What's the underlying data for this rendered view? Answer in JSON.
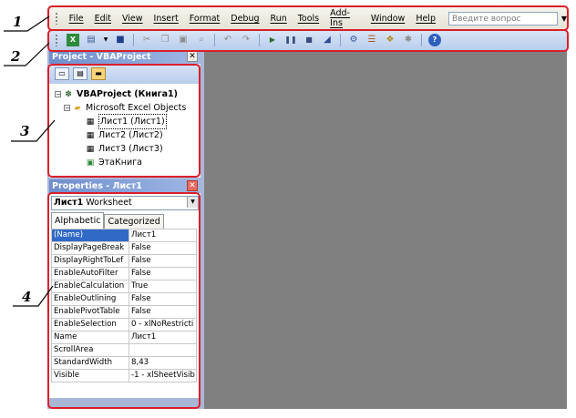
{
  "callouts": [
    "1",
    "2",
    "3",
    "4"
  ],
  "menu": {
    "items": [
      "File",
      "Edit",
      "View",
      "Insert",
      "Format",
      "Debug",
      "Run",
      "Tools",
      "Add-Ins",
      "Window",
      "Help"
    ],
    "help_placeholder": "Введите вопрос"
  },
  "project": {
    "title": "Project - VBAProject",
    "root": "VBAProject (Книга1)",
    "folder": "Microsoft Excel Objects",
    "sheets": [
      "Лист1 (Лист1)",
      "Лист2 (Лист2)",
      "Лист3 (Лист3)"
    ],
    "workbook": "ЭтаКнига"
  },
  "properties": {
    "title": "Properties - Лист1",
    "object_name": "Лист1",
    "object_type": "Worksheet",
    "tabs": [
      "Alphabetic",
      "Categorized"
    ],
    "rows": [
      {
        "key": "(Name)",
        "value": "Лист1"
      },
      {
        "key": "DisplayPageBreak",
        "value": "False"
      },
      {
        "key": "DisplayRightToLef",
        "value": "False"
      },
      {
        "key": "EnableAutoFilter",
        "value": "False"
      },
      {
        "key": "EnableCalculation",
        "value": "True"
      },
      {
        "key": "EnableOutlining",
        "value": "False"
      },
      {
        "key": "EnablePivotTable",
        "value": "False"
      },
      {
        "key": "EnableSelection",
        "value": "0 - xlNoRestricti"
      },
      {
        "key": "Name",
        "value": "Лист1"
      },
      {
        "key": "ScrollArea",
        "value": ""
      },
      {
        "key": "StandardWidth",
        "value": "8,43"
      },
      {
        "key": "Visible",
        "value": "-1 - xlSheetVisib"
      }
    ]
  },
  "colors": {
    "annotation": "#d8202a",
    "code_area": "#808080",
    "title_bar": "#6f8ecd"
  }
}
